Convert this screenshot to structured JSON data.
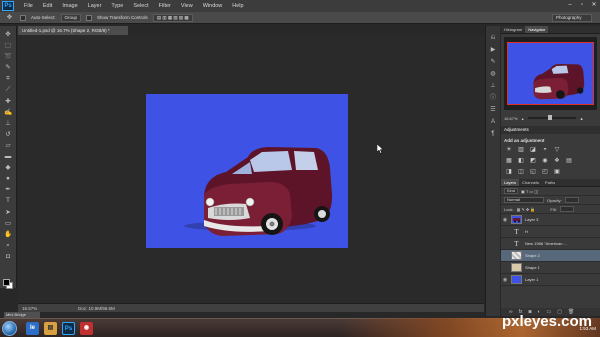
{
  "app": {
    "logo": "Ps"
  },
  "menu": [
    "File",
    "Edit",
    "Image",
    "Layer",
    "Type",
    "Select",
    "Filter",
    "View",
    "Window",
    "Help"
  ],
  "window_controls": [
    "–",
    "▫",
    "✕"
  ],
  "options_bar": {
    "auto_select_label": "Auto-Select:",
    "auto_select_value": "Group",
    "show_transform_label": "Show Transform Controls",
    "workspace": "Photography"
  },
  "document": {
    "tab_title": "Untitled-1.psd @ 16.7% (Shape 2, RGB/8) *",
    "zoom": "16.67%",
    "doc_size": "Doc: 10.9M/96.6M",
    "canvas_color": "#3f52e6"
  },
  "mini_bridge_label": "Mini Bridge",
  "navigator": {
    "tabs": [
      "Histogram",
      "Navigator"
    ],
    "zoom": "16.67%"
  },
  "adjustments": {
    "title": "Adjustments",
    "add_label": "Add an adjustment",
    "row1": [
      "☀",
      "▥",
      "◪",
      "◓",
      "▽"
    ],
    "row2": [
      "▦",
      "◧",
      "◩",
      "◉",
      "❖",
      "▤"
    ],
    "row3": [
      "◨",
      "◫",
      "◱",
      "◰",
      "▣"
    ]
  },
  "layers": {
    "tabs": [
      "Layers",
      "Channels",
      "Paths"
    ],
    "kind": "Kind",
    "blend_mode": "Normal",
    "opacity_label": "Opacity:",
    "lock_label": "Lock:",
    "fill_label": "Fill:",
    "rows": [
      {
        "name": "Layer 3",
        "thumb": "car"
      },
      {
        "name": "H",
        "thumb": "T"
      },
      {
        "name": "New 1968 \"American ...",
        "thumb": "T"
      },
      {
        "name": "Shape 2",
        "thumb": "shape",
        "selected": true
      },
      {
        "name": "Shape 1",
        "thumb": "shape"
      },
      {
        "name": "Layer 1",
        "thumb": "blue"
      }
    ]
  },
  "watermark": "pxleyes.com",
  "clock": "1:53 AM",
  "taskbar_icons": [
    "Ie",
    "▤",
    "Ps",
    "◉"
  ]
}
